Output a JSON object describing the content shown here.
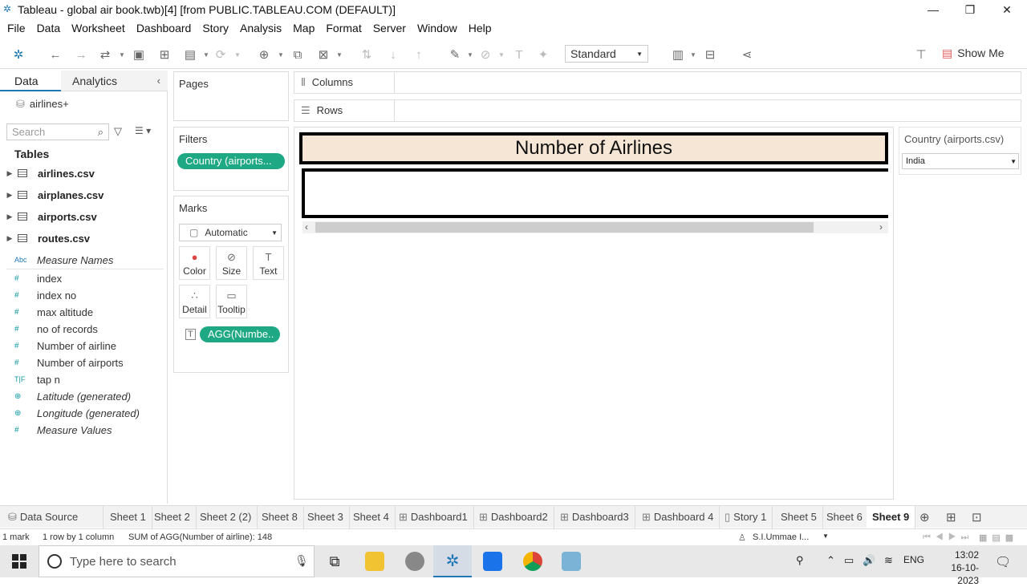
{
  "window": {
    "title": "Tableau - global air book.twb)[4] [from PUBLIC.TABLEAU.COM (DEFAULT)]",
    "minimize": "—",
    "restore": "❐",
    "close": "✕"
  },
  "menu": [
    "File",
    "Data",
    "Worksheet",
    "Dashboard",
    "Story",
    "Analysis",
    "Map",
    "Format",
    "Server",
    "Window",
    "Help"
  ],
  "toolbar": {
    "fit_mode": "Standard",
    "show_me": "Show Me"
  },
  "left_pane": {
    "tab_data": "Data",
    "tab_analytics": "Analytics",
    "datasource": "airlines+",
    "search_placeholder": "Search",
    "tables_header": "Tables",
    "tables": [
      "airlines.csv",
      "airplanes.csv",
      "airports.csv",
      "routes.csv"
    ],
    "fields": [
      {
        "name": "Measure Names",
        "icon": "Abc",
        "italic": true
      },
      {
        "name": "index",
        "icon": "#",
        "italic": false
      },
      {
        "name": "index no",
        "icon": "#",
        "italic": false
      },
      {
        "name": "max altitude",
        "icon": "#",
        "italic": false
      },
      {
        "name": "no of records",
        "icon": "#",
        "italic": false
      },
      {
        "name": "Number of airline",
        "icon": "#",
        "italic": false
      },
      {
        "name": "Number of airports",
        "icon": "#",
        "italic": false
      },
      {
        "name": "tap n",
        "icon": "T|F",
        "italic": false
      },
      {
        "name": "Latitude (generated)",
        "icon": "globe",
        "italic": true
      },
      {
        "name": "Longitude (generated)",
        "icon": "globe",
        "italic": true
      },
      {
        "name": "Measure Values",
        "icon": "#",
        "italic": true
      }
    ]
  },
  "cards": {
    "pages": "Pages",
    "filters": "Filters",
    "filter_pill": "Country (airports...",
    "marks": "Marks",
    "mark_type": "Automatic",
    "mark_buttons": {
      "color": "Color",
      "size": "Size",
      "text": "Text",
      "detail": "Detail",
      "tooltip": "Tooltip"
    },
    "marks_pill": "AGG(Numbe.."
  },
  "shelves": {
    "columns": "Columns",
    "rows": "Rows"
  },
  "view": {
    "title": "Number of Airlines",
    "quick_filter_title": "Country (airports.csv)",
    "quick_filter_value": "India"
  },
  "sheet_tabs": [
    "Data Source",
    "Sheet 1",
    "Sheet 2",
    "Sheet 2 (2)",
    "Sheet 8",
    "Sheet 3",
    "Sheet 4",
    "Dashboard1",
    "Dashboard2",
    "Dashboard3",
    "Dashboard 4",
    "Story 1",
    "Sheet 5",
    "Sheet 6",
    "Sheet 9"
  ],
  "active_tab": "Sheet 9",
  "status": {
    "marks": "1 mark",
    "dims": "1 row by 1 column",
    "sum": "SUM of AGG(Number of airline): 148",
    "user": "S.I.Ummae I..."
  },
  "taskbar": {
    "search_placeholder": "Type here to search",
    "lang": "ENG",
    "time": "13:02",
    "date": "16-10-2023"
  }
}
